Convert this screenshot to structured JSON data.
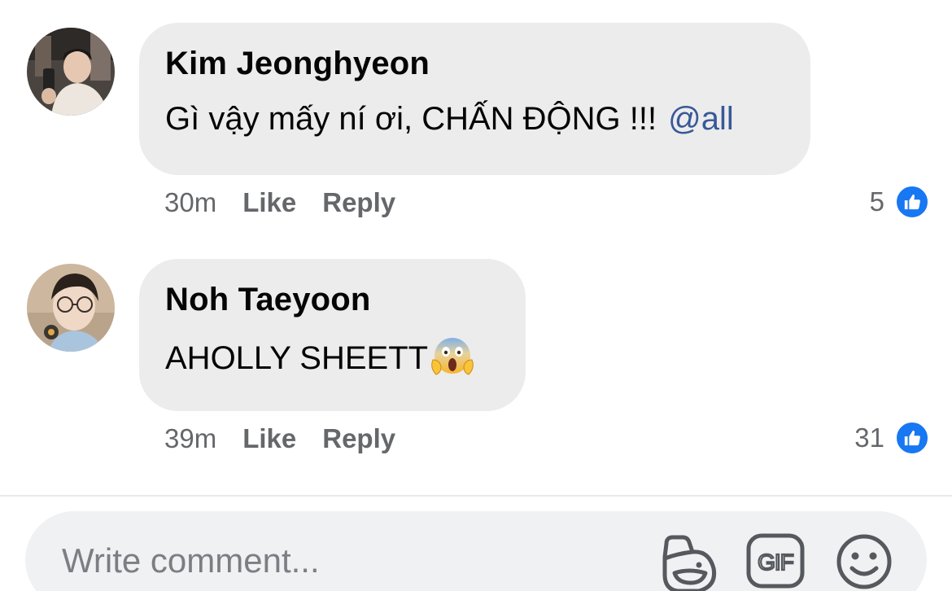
{
  "comments": [
    {
      "author": "Kim Jeonghyeon",
      "text": "Gì vậy mấy ní ơi, CHẤN ĐỘNG !!!",
      "mention": "@all",
      "time": "30m",
      "like_label": "Like",
      "reply_label": "Reply",
      "reaction_count": "5",
      "reaction_icon": "thumbs-up-icon"
    },
    {
      "author": "Noh Taeyoon",
      "text": "AHOLLY SHEETT",
      "emoji": "face-screaming-in-fear",
      "time": "39m",
      "like_label": "Like",
      "reply_label": "Reply",
      "reaction_count": "31",
      "reaction_icon": "thumbs-up-icon"
    }
  ],
  "composer": {
    "placeholder": "Write comment...",
    "sticker_icon": "sticker-icon",
    "gif_label": "GIF",
    "emoji_icon": "smiley-icon"
  },
  "colors": {
    "bubble": "#ececec",
    "mention": "#385898",
    "meta_text": "#65676b",
    "like_badge": "#1877f2",
    "composer_bg": "#f0f1f3"
  }
}
